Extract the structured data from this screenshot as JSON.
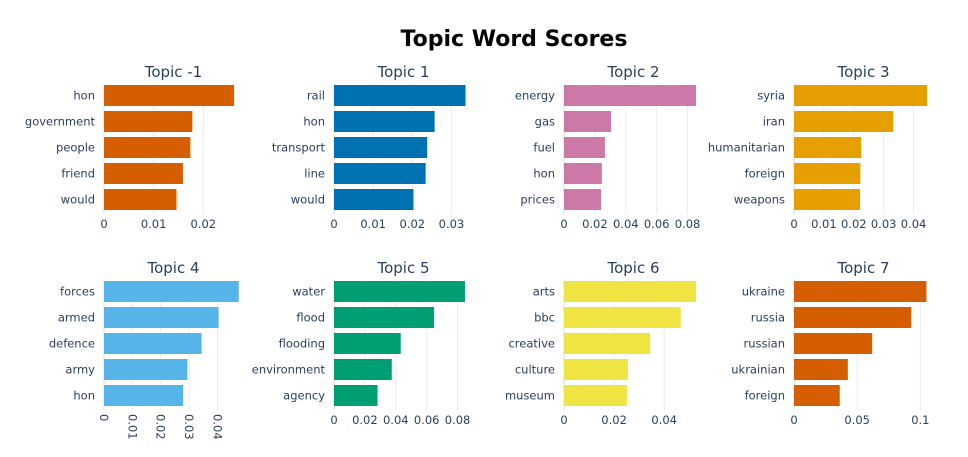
{
  "chart_data": {
    "type": "bar",
    "title": "Topic Word Scores",
    "subplots": [
      {
        "title": "Topic -1",
        "color": "#D55E00",
        "words": [
          "hon",
          "government",
          "people",
          "friend",
          "would"
        ],
        "values": [
          0.0262,
          0.0178,
          0.0174,
          0.0159,
          0.0146
        ],
        "xmax": 0.028,
        "ticks": [
          0,
          0.01,
          0.02
        ],
        "tick_labels": [
          "0",
          "0.01",
          "0.02"
        ],
        "rotated": false
      },
      {
        "title": "Topic 1",
        "color": "#0072B2",
        "words": [
          "rail",
          "hon",
          "transport",
          "line",
          "would"
        ],
        "values": [
          0.0336,
          0.0257,
          0.0238,
          0.0234,
          0.0203
        ],
        "xmax": 0.0355,
        "ticks": [
          0,
          0.01,
          0.02,
          0.03
        ],
        "tick_labels": [
          "0",
          "0.01",
          "0.02",
          "0.03"
        ],
        "rotated": false
      },
      {
        "title": "Topic 2",
        "color": "#CC79A7",
        "words": [
          "energy",
          "gas",
          "fuel",
          "hon",
          "prices"
        ],
        "values": [
          0.0855,
          0.0305,
          0.0265,
          0.0245,
          0.024
        ],
        "xmax": 0.09,
        "ticks": [
          0,
          0.02,
          0.04,
          0.06,
          0.08
        ],
        "tick_labels": [
          "0",
          "0.02",
          "0.04",
          "0.06",
          "0.08"
        ],
        "rotated": false
      },
      {
        "title": "Topic 3",
        "color": "#E69F00",
        "words": [
          "syria",
          "iran",
          "humanitarian",
          "foreign",
          "weapons"
        ],
        "values": [
          0.0445,
          0.0332,
          0.0225,
          0.0222,
          0.0221
        ],
        "xmax": 0.0465,
        "ticks": [
          0,
          0.01,
          0.02,
          0.03,
          0.04
        ],
        "tick_labels": [
          "0",
          "0.01",
          "0.02",
          "0.03",
          "0.04"
        ],
        "rotated": false
      },
      {
        "title": "Topic 4",
        "color": "#56B4E9",
        "words": [
          "forces",
          "armed",
          "defence",
          "army",
          "hon"
        ],
        "values": [
          0.0475,
          0.0404,
          0.0344,
          0.0294,
          0.0279
        ],
        "xmax": 0.049,
        "ticks": [
          0,
          0.01,
          0.02,
          0.03,
          0.04
        ],
        "tick_labels": [
          "0",
          "0.01",
          "0.02",
          "0.03",
          "0.04"
        ],
        "rotated": true
      },
      {
        "title": "Topic 5",
        "color": "#009E73",
        "words": [
          "water",
          "flood",
          "flooding",
          "environment",
          "agency"
        ],
        "values": [
          0.0848,
          0.0648,
          0.0432,
          0.0374,
          0.0282
        ],
        "xmax": 0.09,
        "ticks": [
          0,
          0.02,
          0.04,
          0.06,
          0.08
        ],
        "tick_labels": [
          "0",
          "0.02",
          "0.04",
          "0.06",
          "0.08"
        ],
        "rotated": false
      },
      {
        "title": "Topic 6",
        "color": "#F0E442",
        "words": [
          "arts",
          "bbc",
          "creative",
          "culture",
          "museum"
        ],
        "values": [
          0.0527,
          0.0466,
          0.0344,
          0.0255,
          0.0251
        ],
        "xmax": 0.0555,
        "ticks": [
          0,
          0.02,
          0.04
        ],
        "tick_labels": [
          "0",
          "0.02",
          "0.04"
        ],
        "rotated": false
      },
      {
        "title": "Topic 7",
        "color": "#D55E00",
        "words": [
          "ukraine",
          "russia",
          "russian",
          "ukrainian",
          "foreign"
        ],
        "values": [
          0.1048,
          0.0928,
          0.0619,
          0.0426,
          0.0362
        ],
        "xmax": 0.11,
        "ticks": [
          0,
          0.05,
          0.1
        ],
        "tick_labels": [
          "0",
          "0.05",
          "0.1"
        ],
        "rotated": false
      }
    ]
  }
}
